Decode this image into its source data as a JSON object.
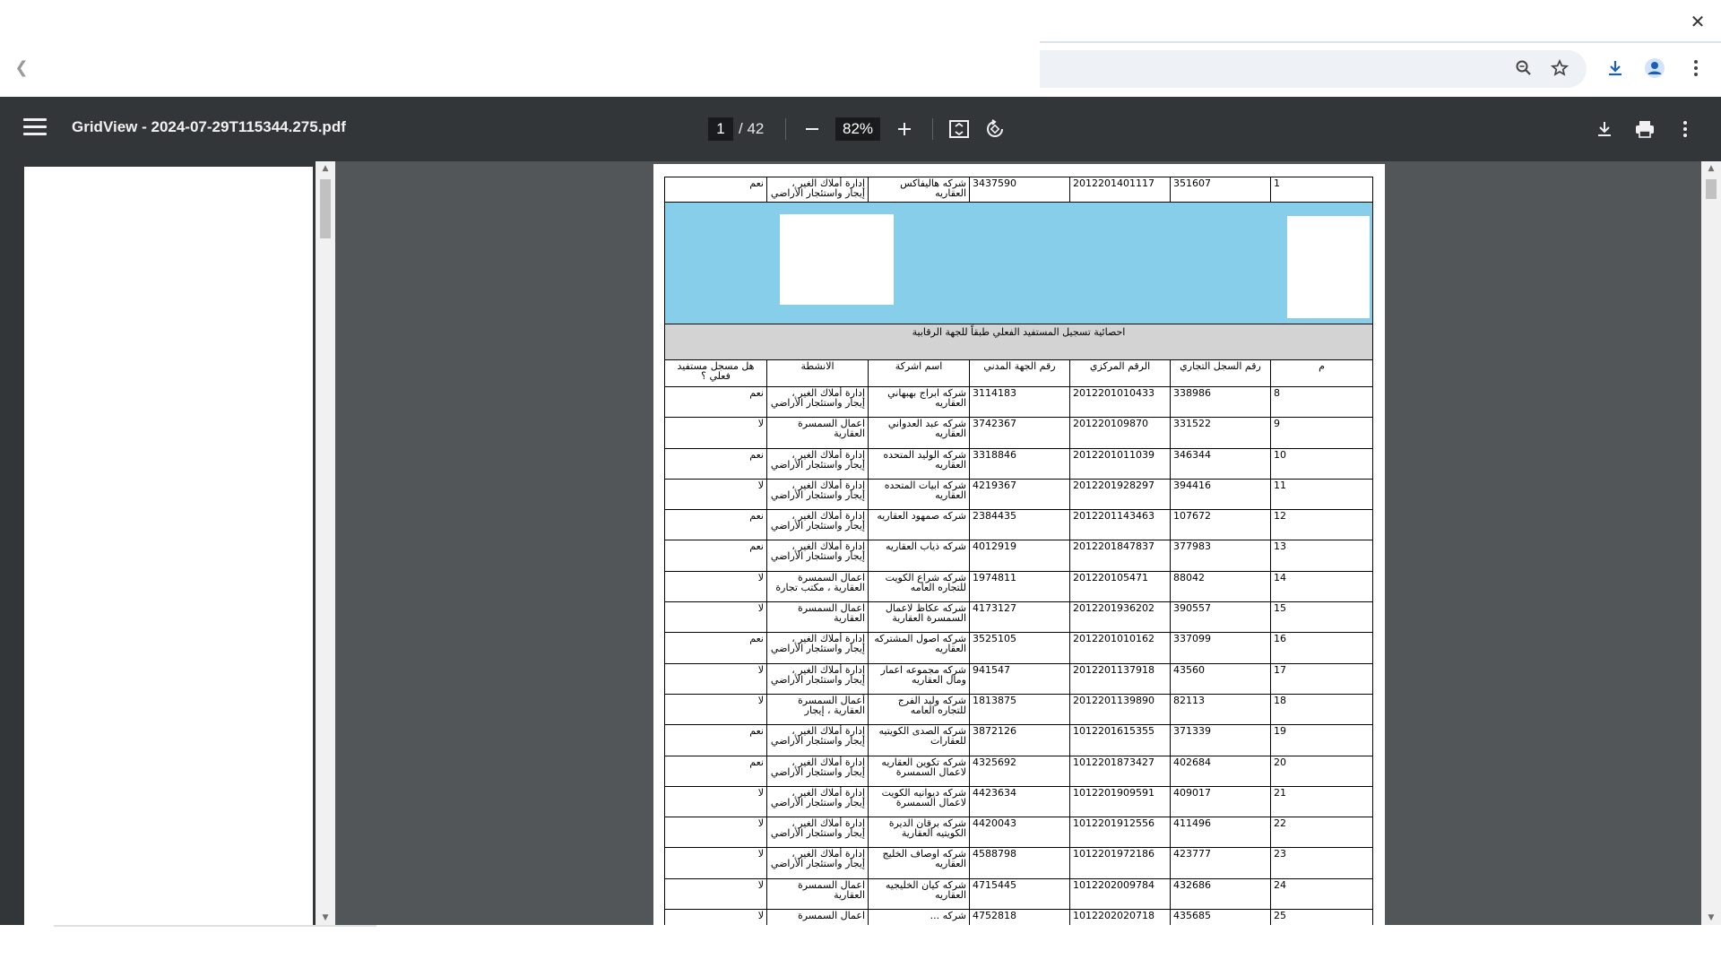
{
  "browser": {
    "close_icon": "close-icon",
    "back_icon": "back-arrow-icon",
    "toolbar_icons": [
      "zoom-icon",
      "star-icon",
      "download-icon",
      "profile-icon",
      "more-vert-icon"
    ]
  },
  "viewer": {
    "title": "GridView - 2024-07-29T115344.275.pdf",
    "page_current": "1",
    "page_total": "/ 42",
    "zoom": "82%"
  },
  "report": {
    "first_row": {
      "serial": "1",
      "commercial_reg": "351607",
      "central_no": "2012201401117",
      "civil_no": "3437590",
      "company": "شركه هاليفاكس العقاريه",
      "activity": "إدارة أملاك الغير ، إيجار واستئجار الأراضي",
      "registered": "نعم"
    },
    "title": "احصائية تسجيل المستفيد الفعلي طبقاً للجهة الرقابية",
    "columns": {
      "serial": "م",
      "commercial_reg": "رقم السجل التجاري",
      "central_no": "الرقم المركزي",
      "civil_no": "رقم الجهة المدني",
      "company": "اسم اشركة",
      "activity": "الانشطة",
      "registered": "هل مسجل مستفيد فعلي ؟"
    },
    "rows": [
      {
        "serial": "8",
        "commercial_reg": "338986",
        "central_no": "2012201010433",
        "civil_no": "3114183",
        "company": "شركه ابراج بهبهاني العقاريه",
        "activity": "إدارة أملاك الغير ، إيجار واستئجار الأراضي",
        "registered": "نعم"
      },
      {
        "serial": "9",
        "commercial_reg": "331522",
        "central_no": "201220109870",
        "civil_no": "3742367",
        "company": "شركه عبد العدواني العقاريه",
        "activity": "اعمال السمسرة العقارية",
        "registered": "لا"
      },
      {
        "serial": "10",
        "commercial_reg": "346344",
        "central_no": "2012201011039",
        "civil_no": "3318846",
        "company": "شركه الوليد المتحده العقاريه",
        "activity": "إدارة أملاك الغير ، إيجار واستئجار الأراضي",
        "registered": "نعم"
      },
      {
        "serial": "11",
        "commercial_reg": "394416",
        "central_no": "2012201928297",
        "civil_no": "4219367",
        "company": "شركه ابيات المتحده العقاريه",
        "activity": "إدارة أملاك الغير ، إيجار واستئجار الأراضي",
        "registered": "لا"
      },
      {
        "serial": "12",
        "commercial_reg": "107672",
        "central_no": "2012201143463",
        "civil_no": "2384435",
        "company": "شركه صمهود العقاريه",
        "activity": "إدارة أملاك الغير ، إيجار واستئجار الأراضي",
        "registered": "نعم"
      },
      {
        "serial": "13",
        "commercial_reg": "377983",
        "central_no": "2012201847837",
        "civil_no": "4012919",
        "company": "شركه ذياب العقاريه",
        "activity": "إدارة أملاك الغير ، إيجار واستئجار الأراضي",
        "registered": "نعم"
      },
      {
        "serial": "14",
        "commercial_reg": "88042",
        "central_no": "201220105471",
        "civil_no": "1974811",
        "company": "شركه شراع الكويت للتجاره العامه",
        "activity": "اعمال السمسرة العقارية ، مكتب تجارة",
        "registered": "لا"
      },
      {
        "serial": "15",
        "commercial_reg": "390557",
        "central_no": "2012201936202",
        "civil_no": "4173127",
        "company": "شركه عكاظ لاعمال السمسرة العقارية",
        "activity": "اعمال السمسرة العقارية",
        "registered": "لا"
      },
      {
        "serial": "16",
        "commercial_reg": "337099",
        "central_no": "2012201010162",
        "civil_no": "3525105",
        "company": "شركه اصول المشتركه العقاريه",
        "activity": "إدارة أملاك الغير ، إيجار واستئجار الأراضي",
        "registered": "نعم"
      },
      {
        "serial": "17",
        "commercial_reg": "43560",
        "central_no": "2012201137918",
        "civil_no": "941547",
        "company": "شركه مجموعه اعمار ومال العقاريه",
        "activity": "إدارة أملاك الغير ، إيجار واستئجار الأراضي",
        "registered": "لا"
      },
      {
        "serial": "18",
        "commercial_reg": "82113",
        "central_no": "2012201139890",
        "civil_no": "1813875",
        "company": "شركه وليد الفرج للتجاره العامه",
        "activity": "أعمال السمسرة العقارية ، إيجار",
        "registered": "لا"
      },
      {
        "serial": "19",
        "commercial_reg": "371339",
        "central_no": "1012201615355",
        "civil_no": "3872126",
        "company": "شركه الصدى الكويتيه للعقارات",
        "activity": "إدارة أملاك الغير ، إيجار واستئجار الأراضي",
        "registered": "نعم"
      },
      {
        "serial": "20",
        "commercial_reg": "402684",
        "central_no": "1012201873427",
        "civil_no": "4325692",
        "company": "شركه تكوين العقاريه لاعمال السمسرة",
        "activity": "إدارة أملاك الغير ، إيجار واستئجار الأراضي",
        "registered": "نعم"
      },
      {
        "serial": "21",
        "commercial_reg": "409017",
        "central_no": "1012201909591",
        "civil_no": "4423634",
        "company": "شركه ديوانيه الكويت لاعمال السمسرة",
        "activity": "إدارة أملاك الغير ، إيجار واستئجار الأراضي",
        "registered": "لا"
      },
      {
        "serial": "22",
        "commercial_reg": "411496",
        "central_no": "1012201912556",
        "civil_no": "4420043",
        "company": "شركه برقان الديرة الكويتيه العقارية",
        "activity": "إدارة أملاك الغير ، إيجار واستئجار الأراضي",
        "registered": "لا"
      },
      {
        "serial": "23",
        "commercial_reg": "423777",
        "central_no": "1012201972186",
        "civil_no": "4588798",
        "company": "شركه اوصاف الخليج العقاريه",
        "activity": "إدارة أملاك الغير ، إيجار واستئجار الأراضي",
        "registered": "لا"
      },
      {
        "serial": "24",
        "commercial_reg": "432686",
        "central_no": "1012202009784",
        "civil_no": "4715445",
        "company": "شركه كيان الخليجيه العقاريه",
        "activity": "اعمال السمسرة العقارية",
        "registered": "لا"
      },
      {
        "serial": "25",
        "commercial_reg": "435685",
        "central_no": "1012202020718",
        "civil_no": "4752818",
        "company": "شركه ...",
        "activity": "اعمال السمسرة",
        "registered": "لا"
      }
    ]
  },
  "colors": {
    "header_bg": "#323639",
    "viewer_bg": "#525659",
    "banner_bg": "#87ceeb",
    "title_band_bg": "#d3d3d3"
  }
}
